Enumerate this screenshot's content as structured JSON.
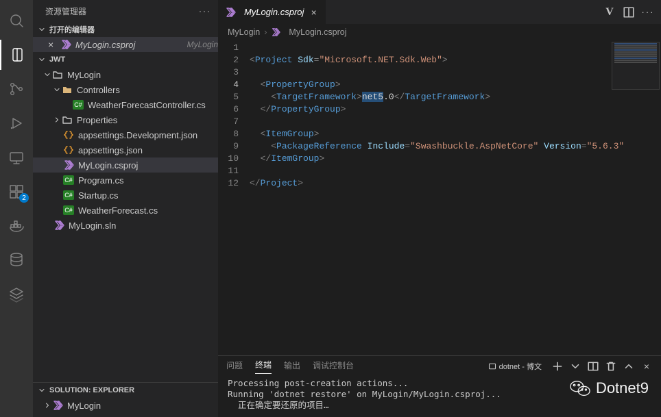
{
  "explorer": {
    "title": "资源管理器",
    "open_editors_label": "打开的编辑器",
    "workspace_name": "JWT",
    "solution_label": "SOLUTION: EXPLORER",
    "solution_root": "MyLogin",
    "open_editor_file": "MyLogin.csproj",
    "open_editor_folder": "MyLogin",
    "tree": {
      "project": "MyLogin",
      "controllers": "Controllers",
      "weather_ctrl": "WeatherForecastController.cs",
      "properties": "Properties",
      "appsettings_dev": "appsettings.Development.json",
      "appsettings": "appsettings.json",
      "csproj": "MyLogin.csproj",
      "program": "Program.cs",
      "startup": "Startup.cs",
      "weather": "WeatherForecast.cs",
      "sln": "MyLogin.sln"
    }
  },
  "tabs": {
    "file": "MyLogin.csproj"
  },
  "breadcrumbs": {
    "root": "MyLogin",
    "file": "MyLogin.csproj"
  },
  "code": {
    "l1": {
      "a": "Project",
      "b": "Sdk",
      "c": "\"Microsoft.NET.Sdk.Web\""
    },
    "l3": {
      "a": "PropertyGroup"
    },
    "l4": {
      "a": "TargetFramework",
      "sel": "net5",
      "rest": ".0"
    },
    "l5": {
      "a": "PropertyGroup"
    },
    "l7": {
      "a": "ItemGroup"
    },
    "l8": {
      "a": "PackageReference",
      "b": "Include",
      "c": "\"Swashbuckle.AspNetCore\"",
      "d": "Version",
      "e": "\"5.6.3\""
    },
    "l9": {
      "a": "ItemGroup"
    },
    "l11": {
      "a": "Project"
    }
  },
  "panel": {
    "tabs": {
      "problems": "问题",
      "terminal": "终端",
      "output": "输出",
      "debug": "调试控制台"
    },
    "term_name": "dotnet - 博文",
    "line1": "Processing post-creation actions...",
    "line2": "Running 'dotnet restore' on MyLogin/MyLogin.csproj...",
    "line3": "  正在确定要还原的项目…"
  },
  "extensions_badge": "2",
  "watermark": "Dotnet9"
}
